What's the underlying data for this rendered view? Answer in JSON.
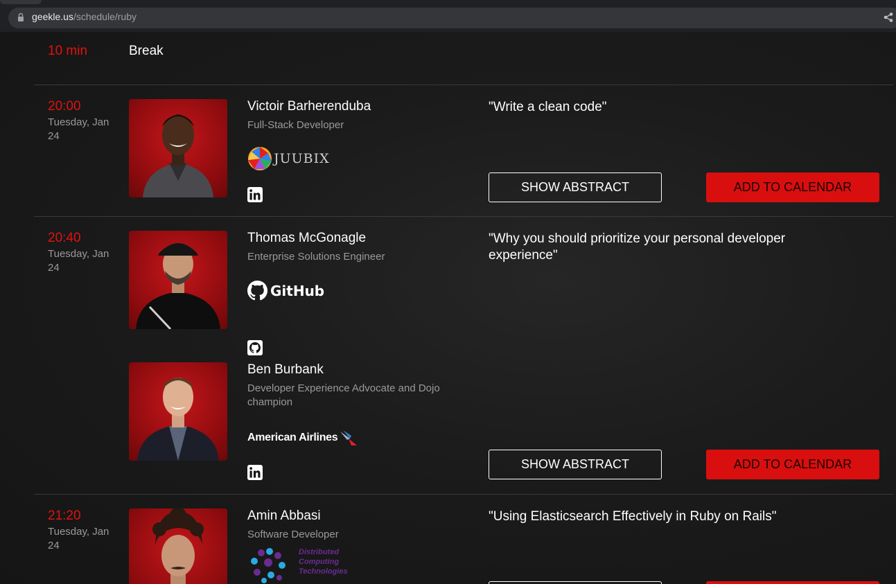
{
  "browser": {
    "url_host": "geekle.us",
    "url_path": "/schedule/ruby"
  },
  "break": {
    "duration": "10 min",
    "label": "Break"
  },
  "sessions": [
    {
      "time": "20:00",
      "date": "Tuesday, Jan 24",
      "title": "\"Write a clean code\"",
      "speakers": [
        {
          "name": "Victoir Barherenduba",
          "role": "Full-Stack Developer",
          "company_logo": "JUUBIX",
          "social_icon": "linkedin-icon"
        }
      ],
      "show_abstract_label": "SHOW ABSTRACT",
      "add_calendar_label": "ADD TO CALENDAR"
    },
    {
      "time": "20:40",
      "date": "Tuesday, Jan 24",
      "title": "\"Why you should prioritize your personal developer experience\"",
      "speakers": [
        {
          "name": "Thomas McGonagle",
          "role": "Enterprise Solutions Engineer",
          "company_logo": "GitHub",
          "social_icon": "github-icon"
        },
        {
          "name": "Ben Burbank",
          "role": "Developer Experience Advocate and Dojo champion",
          "company_logo": "American Airlines",
          "social_icon": "linkedin-icon"
        }
      ],
      "show_abstract_label": "SHOW ABSTRACT",
      "add_calendar_label": "ADD TO CALENDAR"
    },
    {
      "time": "21:20",
      "date": "Tuesday, Jan 24",
      "title": "\"Using Elasticsearch Effectively in Ruby on Rails\"",
      "speakers": [
        {
          "name": "Amin Abbasi",
          "role": "Software Developer",
          "company_logo_lines": [
            "Distributed",
            "Computing",
            "Technologies"
          ],
          "social_icon": "linkedin-icon"
        }
      ]
    }
  ],
  "colors": {
    "accent_red": "#e1120f",
    "button_red": "#d90f0f",
    "background": "#161616"
  }
}
